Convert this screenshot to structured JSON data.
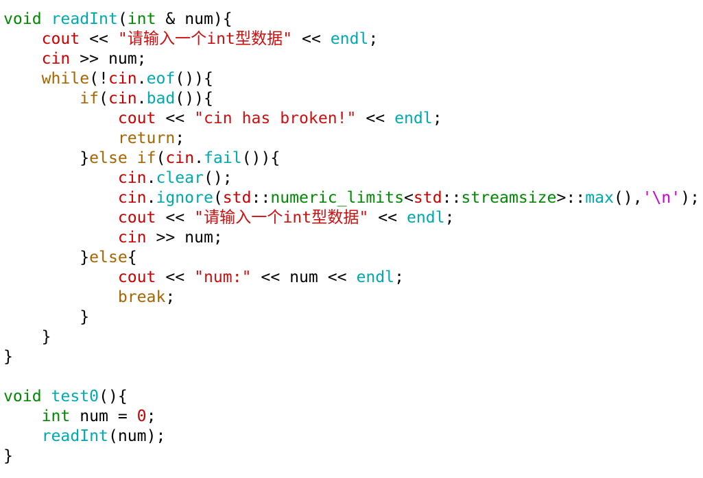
{
  "lines": [
    [
      [
        "kw",
        "void"
      ],
      [
        "pl",
        " "
      ],
      [
        "fn",
        "readInt"
      ],
      [
        "pl",
        "("
      ],
      [
        "kw",
        "int"
      ],
      [
        "pl",
        " & num){"
      ]
    ],
    [
      [
        "pl",
        "    "
      ],
      [
        "io",
        "cout"
      ],
      [
        "pl",
        " << "
      ],
      [
        "str",
        "\"请输入一个int型数据\""
      ],
      [
        "pl",
        " << "
      ],
      [
        "fn",
        "endl"
      ],
      [
        "pl",
        ";"
      ]
    ],
    [
      [
        "pl",
        "    "
      ],
      [
        "io",
        "cin"
      ],
      [
        "pl",
        " >> num;"
      ]
    ],
    [
      [
        "pl",
        "    "
      ],
      [
        "ctl",
        "while"
      ],
      [
        "pl",
        "(!"
      ],
      [
        "io",
        "cin"
      ],
      [
        "pl",
        "."
      ],
      [
        "fn",
        "eof"
      ],
      [
        "pl",
        "()){"
      ]
    ],
    [
      [
        "pl",
        "        "
      ],
      [
        "ctl",
        "if"
      ],
      [
        "pl",
        "("
      ],
      [
        "io",
        "cin"
      ],
      [
        "pl",
        "."
      ],
      [
        "fn",
        "bad"
      ],
      [
        "pl",
        "()){"
      ]
    ],
    [
      [
        "pl",
        "            "
      ],
      [
        "io",
        "cout"
      ],
      [
        "pl",
        " << "
      ],
      [
        "str",
        "\"cin has broken!\""
      ],
      [
        "pl",
        " << "
      ],
      [
        "fn",
        "endl"
      ],
      [
        "pl",
        ";"
      ]
    ],
    [
      [
        "pl",
        "            "
      ],
      [
        "ctl",
        "return"
      ],
      [
        "pl",
        ";"
      ]
    ],
    [
      [
        "pl",
        "        }"
      ],
      [
        "ctl",
        "else"
      ],
      [
        "pl",
        " "
      ],
      [
        "ctl",
        "if"
      ],
      [
        "pl",
        "("
      ],
      [
        "io",
        "cin"
      ],
      [
        "pl",
        "."
      ],
      [
        "fn",
        "fail"
      ],
      [
        "pl",
        "()){"
      ]
    ],
    [
      [
        "pl",
        "            "
      ],
      [
        "io",
        "cin"
      ],
      [
        "pl",
        "."
      ],
      [
        "fn",
        "clear"
      ],
      [
        "pl",
        "();"
      ]
    ],
    [
      [
        "pl",
        "            "
      ],
      [
        "io",
        "cin"
      ],
      [
        "pl",
        "."
      ],
      [
        "fn",
        "ignore"
      ],
      [
        "pl",
        "("
      ],
      [
        "io",
        "std"
      ],
      [
        "pl",
        "::"
      ],
      [
        "kw",
        "numeric_limits"
      ],
      [
        "pl",
        "<"
      ],
      [
        "io",
        "std"
      ],
      [
        "pl",
        "::"
      ],
      [
        "kw",
        "streamsize"
      ],
      [
        "pl",
        ">::"
      ],
      [
        "fn",
        "max"
      ],
      [
        "pl",
        "(),"
      ],
      [
        "mag",
        "'\\n'"
      ],
      [
        "pl",
        ");"
      ]
    ],
    [
      [
        "pl",
        "            "
      ],
      [
        "io",
        "cout"
      ],
      [
        "pl",
        " << "
      ],
      [
        "str",
        "\"请输入一个int型数据\""
      ],
      [
        "pl",
        " << "
      ],
      [
        "fn",
        "endl"
      ],
      [
        "pl",
        ";"
      ]
    ],
    [
      [
        "pl",
        "            "
      ],
      [
        "io",
        "cin"
      ],
      [
        "pl",
        " >> num;"
      ]
    ],
    [
      [
        "pl",
        "        }"
      ],
      [
        "ctl",
        "else"
      ],
      [
        "pl",
        "{"
      ]
    ],
    [
      [
        "pl",
        "            "
      ],
      [
        "io",
        "cout"
      ],
      [
        "pl",
        " << "
      ],
      [
        "str",
        "\"num:\""
      ],
      [
        "pl",
        " << num << "
      ],
      [
        "fn",
        "endl"
      ],
      [
        "pl",
        ";"
      ]
    ],
    [
      [
        "pl",
        "            "
      ],
      [
        "ctl",
        "break"
      ],
      [
        "pl",
        ";"
      ]
    ],
    [
      [
        "pl",
        "        }"
      ]
    ],
    [
      [
        "pl",
        "    }"
      ]
    ],
    [
      [
        "pl",
        "}"
      ]
    ],
    [],
    [
      [
        "kw",
        "void"
      ],
      [
        "pl",
        " "
      ],
      [
        "fn",
        "test0"
      ],
      [
        "pl",
        "(){"
      ]
    ],
    [
      [
        "pl",
        "    "
      ],
      [
        "kw",
        "int"
      ],
      [
        "pl",
        " num = "
      ],
      [
        "num",
        "0"
      ],
      [
        "pl",
        ";"
      ]
    ],
    [
      [
        "pl",
        "    "
      ],
      [
        "fn",
        "readInt"
      ],
      [
        "pl",
        "(num);"
      ]
    ],
    [
      [
        "pl",
        "}"
      ]
    ]
  ],
  "colors": {
    "plain": "#000000",
    "keyword_type": "#008800",
    "function": "#00a8b0",
    "io_object": "#c80000",
    "control": "#a86400",
    "string": "#cc1010",
    "char_literal": "#cc00cc",
    "number": "#c80000",
    "background": "#ffffff"
  }
}
